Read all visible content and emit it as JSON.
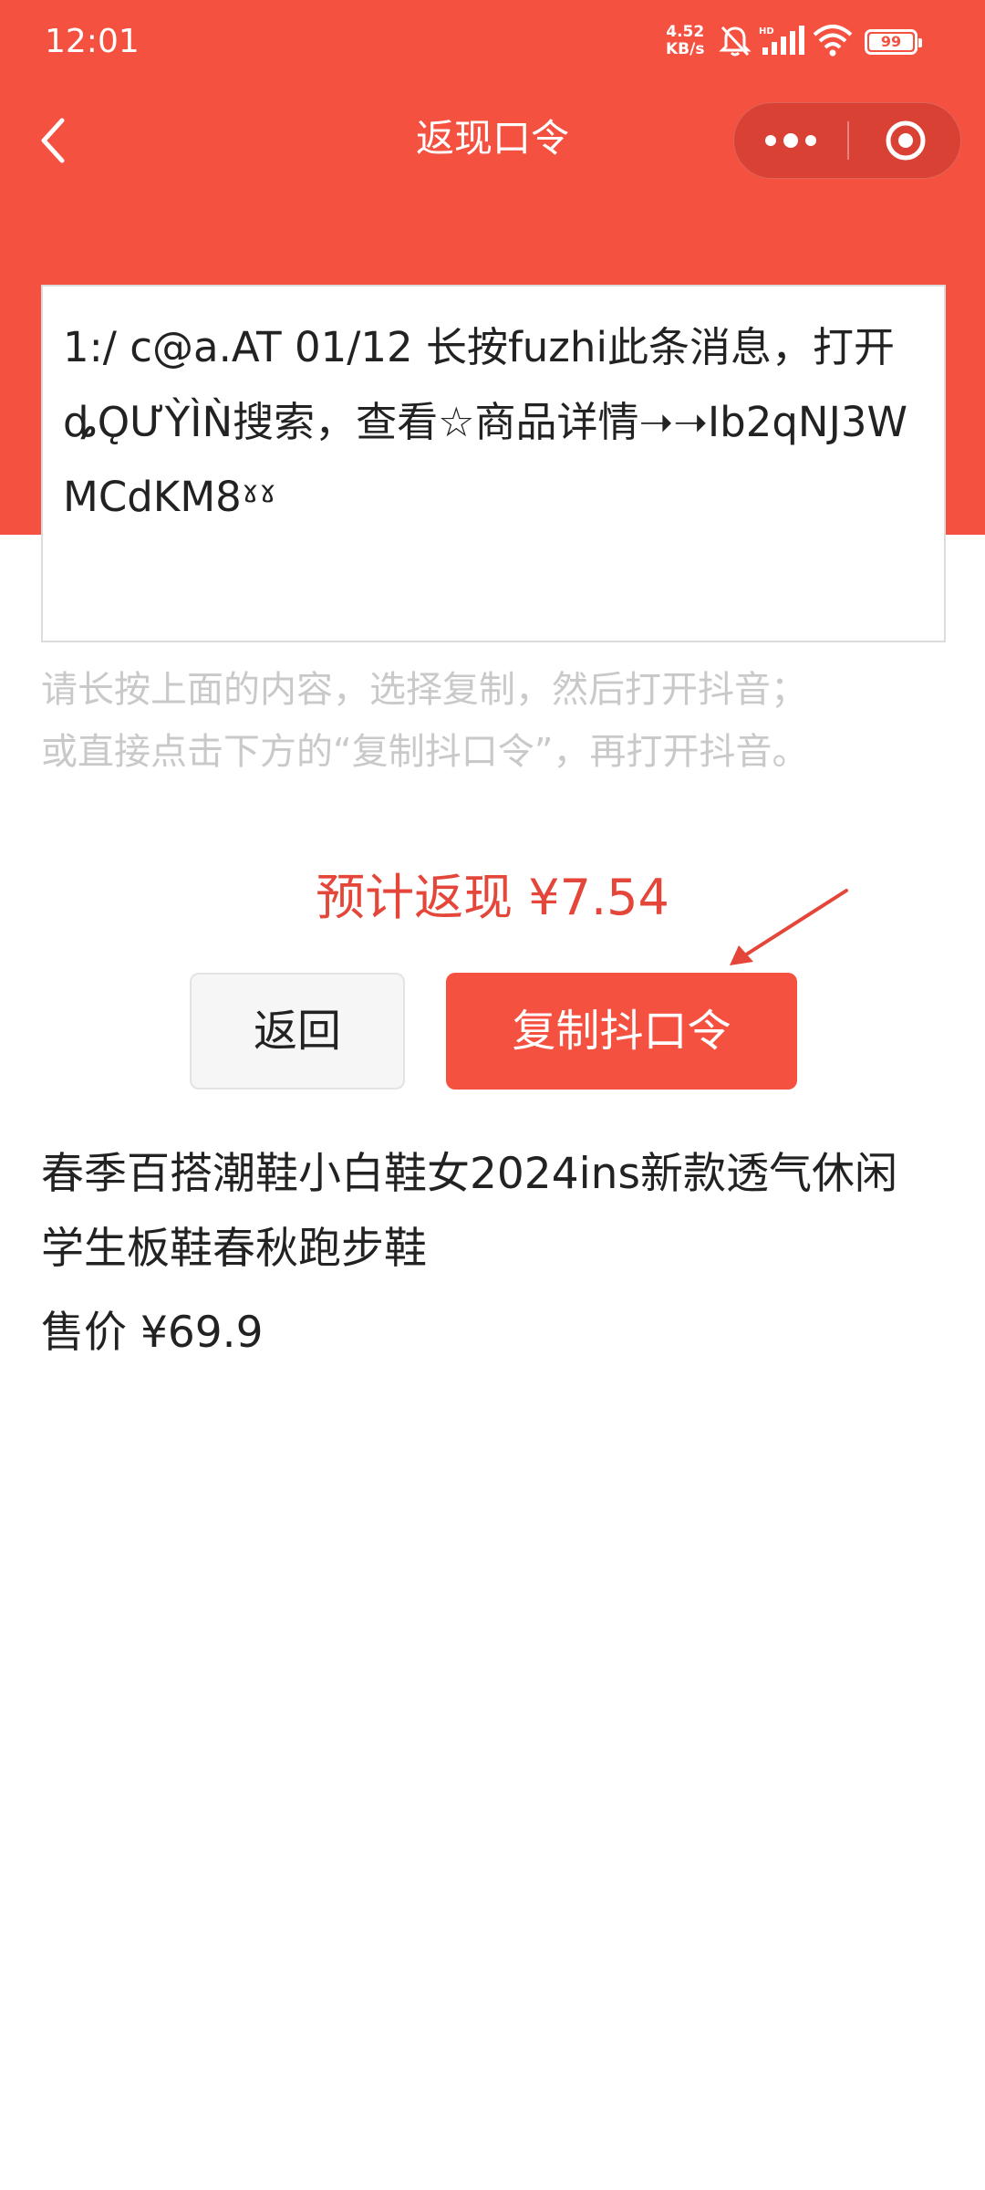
{
  "status_bar": {
    "time": "12:01",
    "net_speed_value": "4.52",
    "net_speed_unit": "KB/s",
    "battery": "99",
    "icons": [
      "bell-off-icon",
      "signal-icon",
      "wifi-icon",
      "battery-icon"
    ]
  },
  "nav": {
    "title": "返现口令",
    "back_icon": "chevron-left-icon",
    "capsule_icons": [
      "more-dots-icon",
      "target-close-icon"
    ]
  },
  "command": {
    "text": "1:/ c@a.AT 01/12 长按fuzhi此条消息，打开ȡǪƯỲÌǸ搜索，查看☆商品详情➝➝Ib2qNJ3WMCdKM8ˠˠ"
  },
  "hint": {
    "line1": "请长按上面的内容，选择复制，然后打开抖音；",
    "line2": "或直接点击下方的“复制抖口令”，再打开抖音。"
  },
  "cashback": {
    "text": "预计返现 ¥7.54"
  },
  "buttons": {
    "back_label": "返回",
    "copy_label": "复制抖口令"
  },
  "product": {
    "title_line1": "春季百搭潮鞋小白鞋女2024ins新款透气休闲",
    "title_line2": "学生板鞋春秋跑步鞋",
    "price": "售价 ¥69.9"
  },
  "colors": {
    "brand_red": "#f55141",
    "cashback_red": "#e4473a",
    "hint_gray": "#c9c9c9"
  }
}
